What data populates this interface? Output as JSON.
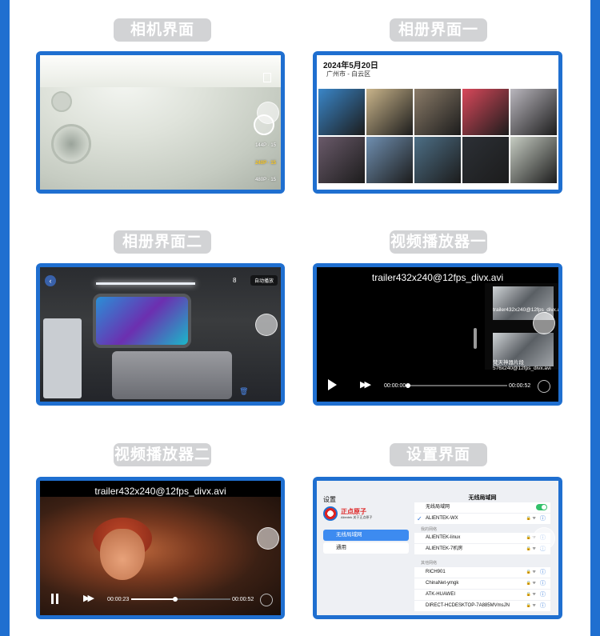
{
  "panels": {
    "camera": {
      "label": "相机界面",
      "resolutions": [
        "144P · 15",
        "240P · 15",
        "480P · 15"
      ],
      "selected_resolution": "240P · 15"
    },
    "album1": {
      "label": "相册界面一",
      "date": "2024年5月20日",
      "location": "广州市 - 白云区",
      "photos": [
        "#3a86c8",
        "#c9b48a",
        "#8a7b68",
        "#d8485a",
        "#b9b6bd",
        "#6a5a6a",
        "#6f8fb0",
        "#4d6f86",
        "#2c3036",
        "#c6ccc2"
      ]
    },
    "album2": {
      "label": "相册界面二",
      "counter": "8",
      "auto_play": "自动播放"
    },
    "video1": {
      "label": "视频播放器一",
      "title": "trailer432x240@12fps_divx.avi",
      "current_time": "00:00:00",
      "total_time": "00:00:52",
      "progress": 0.0,
      "playlist": [
        "trailer432x240@12fps_divx.avi",
        "梵天神器片段576x240@12fps_divx.avi"
      ]
    },
    "video2": {
      "label": "视频播放器二",
      "title": "trailer432x240@12fps_divx.avi",
      "current_time": "00:00:23",
      "total_time": "00:00:52",
      "progress": 0.44
    },
    "settings": {
      "label": "设置界面",
      "header": "设置",
      "brand_name": "正点原子",
      "brand_sub": "Alientek 关于正点原子",
      "nav_wlan": "无线局域网",
      "nav_general": "通用",
      "pane_title": "无线局域网",
      "wlan_label": "无线局域网",
      "connected": "ALIENTEK-WX",
      "my_networks_header": "我的网络",
      "my_networks": [
        "ALIENTEK-linux",
        "ALIENTEK-7机房"
      ],
      "other_networks_header": "其他网络",
      "other_networks": [
        "RICH901",
        "ChinaNet-ymgk",
        "ATK-HUAWEI",
        "DIRECT-HCDESKTOP-7A885MVmsJN"
      ]
    }
  },
  "colors": {
    "frame": "#1f6fd0",
    "label_bg": "#d2d3d5",
    "resolution_selected": "#ffcc22"
  }
}
